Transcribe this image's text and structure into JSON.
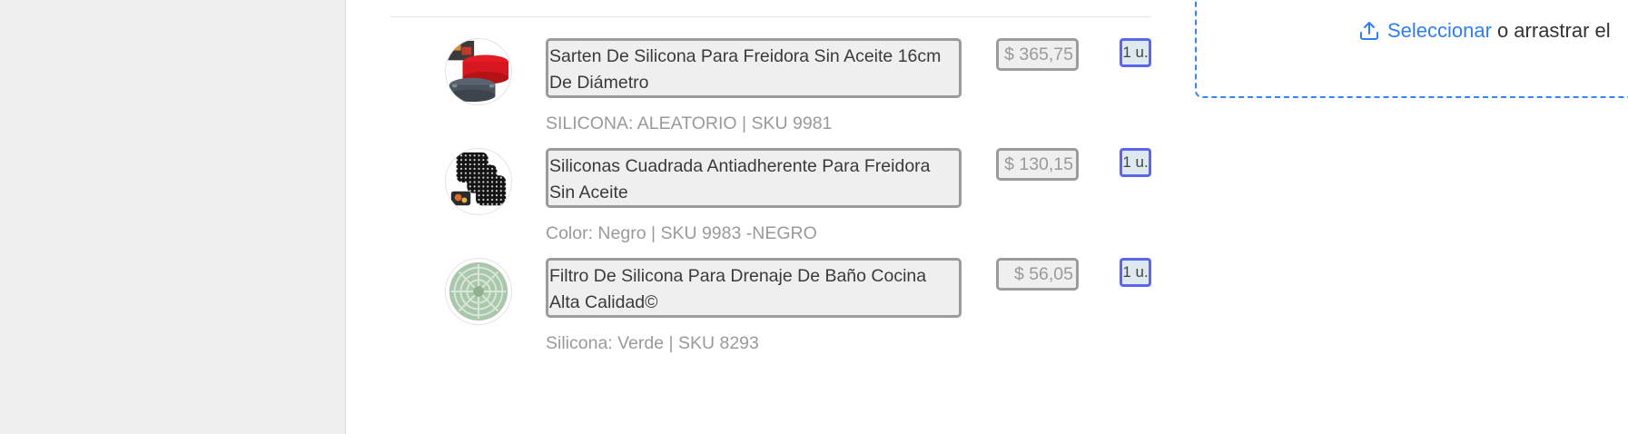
{
  "products": [
    {
      "title": "Sarten De Silicona Para Freidora Sin Aceite 16cm De Diámetro",
      "variant": "SILICONA: ALEATORIO | SKU 9981",
      "price": "$ 365,75",
      "quantity": "1 u.",
      "thumbnail_icon": "silicone-pan-image"
    },
    {
      "title": "Siliconas Cuadrada Antiadherente Para Freidora Sin Aceite",
      "variant": "Color: Negro | SKU 9983 -NEGRO",
      "price": "$ 130,15",
      "quantity": "1 u.",
      "thumbnail_icon": "square-silicone-mats-image"
    },
    {
      "title": "Filtro De Silicona Para Drenaje De Baño Cocina Alta Calidad©",
      "variant": "Silicona: Verde | SKU 8293",
      "price": "$ 56,05",
      "quantity": "1 u.",
      "thumbnail_icon": "green-drain-filter-image"
    }
  ],
  "upload": {
    "link_text": "Seleccionar",
    "rest_text": "o arrastrar el",
    "icon": "upload-icon",
    "accent_color": "#2f7ff0"
  },
  "colors": {
    "left_panel": "#efefef",
    "quantity_border": "#5b66ee",
    "field_border": "#9b9b9b"
  }
}
